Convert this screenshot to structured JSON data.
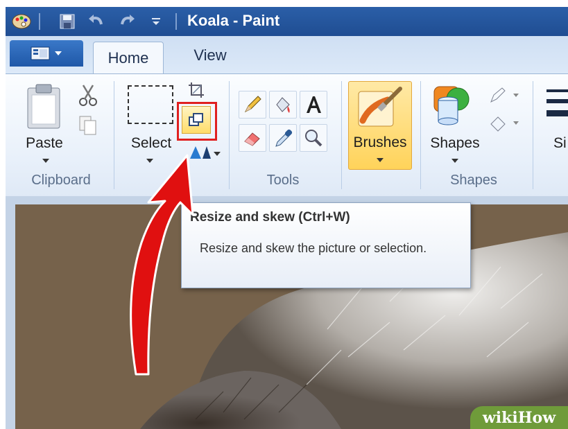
{
  "window": {
    "title": "Koala - Paint"
  },
  "ribbon": {
    "tabs": [
      {
        "label": "Home"
      },
      {
        "label": "View"
      }
    ],
    "groups": {
      "clipboard": {
        "label": "Clipboard",
        "paste_label": "Paste"
      },
      "image": {
        "select_label": "Select"
      },
      "tools": {
        "label": "Tools"
      },
      "brushes": {
        "label": "Brushes"
      },
      "shapes": {
        "label": "Shapes",
        "shapes_label": "Shapes"
      },
      "size": {
        "label_partial": "Si"
      }
    }
  },
  "tooltip": {
    "title": "Resize and skew (Ctrl+W)",
    "body": "Resize and skew the picture or selection."
  },
  "watermark": {
    "text": "wikiHow"
  },
  "colors": {
    "titlebar": "#1f4d92",
    "highlight": "#e02020",
    "brushes_active": "#ffd35a",
    "arrow": "#e01010"
  }
}
